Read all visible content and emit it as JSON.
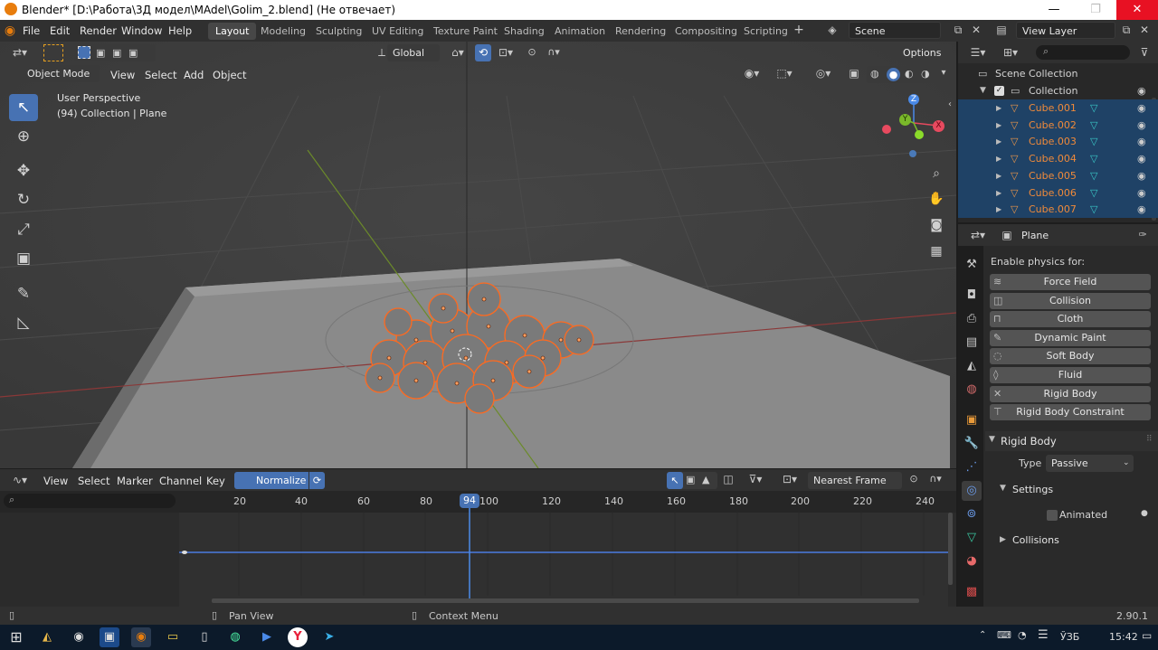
{
  "window": {
    "title": "Blender* [D:\\Работа\\3Д модел\\MAdel\\Golim_2.blend] (Не отвечает)",
    "minimize": "—",
    "maximize": "❐",
    "close": "✕"
  },
  "menu": [
    "File",
    "Edit",
    "Render",
    "Window",
    "Help"
  ],
  "workspaces": [
    "Layout",
    "Modeling",
    "Sculpting",
    "UV Editing",
    "Texture Paint",
    "Shading",
    "Animation",
    "Rendering",
    "Compositing",
    "Scripting"
  ],
  "active_workspace": "Layout",
  "scene": {
    "name": "Scene",
    "view_layer": "View Layer"
  },
  "toolbar": {
    "orientation": "Global",
    "options": "Options"
  },
  "viewport": {
    "mode": "Object Mode",
    "menus": [
      "View",
      "Select",
      "Add",
      "Object"
    ],
    "info_line1": "User Perspective",
    "info_line2": "(94) Collection | Plane",
    "gizmo": {
      "x": "X",
      "y": "Y",
      "z": "Z"
    }
  },
  "outliner": {
    "scene_collection": "Scene Collection",
    "collection": "Collection",
    "objects": [
      "Cube.001",
      "Cube.002",
      "Cube.003",
      "Cube.004",
      "Cube.005",
      "Cube.006",
      "Cube.007"
    ]
  },
  "properties": {
    "object_name": "Plane",
    "enable_physics_label": "Enable physics for:",
    "physics_buttons": [
      {
        "label": "Force Field",
        "icon": "≋"
      },
      {
        "label": "Collision",
        "icon": "◫"
      },
      {
        "label": "Cloth",
        "icon": "⊓"
      },
      {
        "label": "Dynamic Paint",
        "icon": "✎"
      },
      {
        "label": "Soft Body",
        "icon": "◌"
      },
      {
        "label": "Fluid",
        "icon": "◊"
      },
      {
        "label": "Rigid Body",
        "icon": "✕"
      },
      {
        "label": "Rigid Body Constraint",
        "icon": "⊤"
      }
    ],
    "rigid_body_header": "Rigid Body",
    "type_label": "Type",
    "type_value": "Passive",
    "settings_header": "Settings",
    "animated_label": "Animated",
    "collisions_header": "Collisions"
  },
  "timeline": {
    "menus": [
      "View",
      "Select",
      "Marker",
      "Channel",
      "Key"
    ],
    "normalize": "Normalize",
    "interpolation": "Nearest Frame",
    "current_frame": "94",
    "frames": [
      "20",
      "40",
      "60",
      "80",
      "100",
      "120",
      "140",
      "160",
      "180",
      "200",
      "220",
      "240"
    ]
  },
  "status": {
    "pan": "Pan View",
    "context": "Context Menu",
    "version": "2.90.1"
  },
  "taskbar": {
    "lang": "ЎЗБ",
    "time": "15:42"
  }
}
